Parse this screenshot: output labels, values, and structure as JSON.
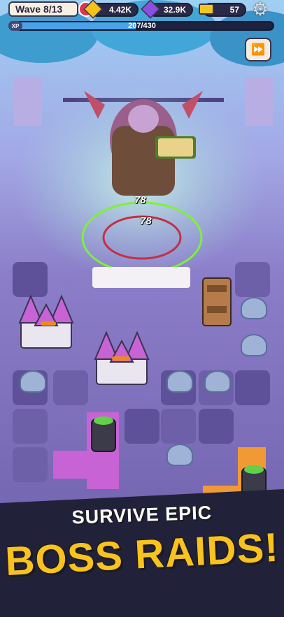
{
  "hud": {
    "wave_label": "Wave 8/13",
    "gold": "4.42K",
    "gems": "32.9K",
    "tickets": "57",
    "xp_tag": "XP",
    "xp_text": "207/430",
    "xp_progress": 0.48
  },
  "battle": {
    "damage_1": "78",
    "damage_2": "78"
  },
  "banner": {
    "line1": "SURVIVE EPIC",
    "line2": "BOSS RAIDS!"
  },
  "colors": {
    "bg_top": "#a7c6ee",
    "bg_mid": "#8f86cc",
    "ground": "#6a5ca6",
    "accent_gold": "#f9c21e",
    "banner_dark": "#22213a"
  }
}
